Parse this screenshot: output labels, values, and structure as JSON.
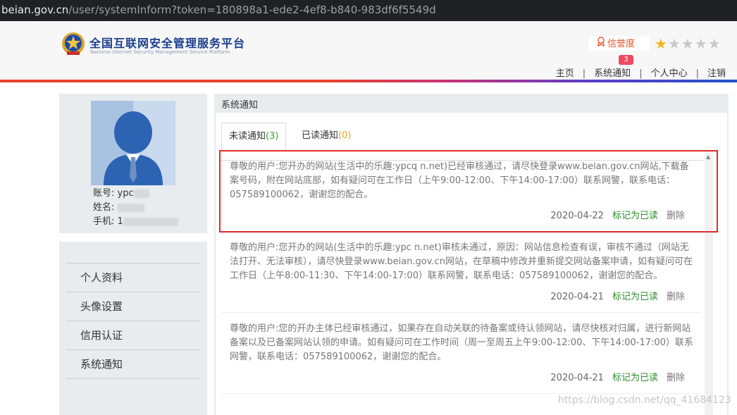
{
  "browser": {
    "host": "beian.gov.cn",
    "path": "/user/systemInform?token=180898a1-ede2-4ef8-b840-983df6f5549d"
  },
  "header": {
    "site_title": "全国互联网安全管理服务平台",
    "site_subtitle": "National Internet Security Management Service Platform",
    "credit_label": "信誉度",
    "rating": {
      "filled": 1,
      "total": 5
    },
    "nav": {
      "home": "主页",
      "notifications": "系统通知",
      "notifications_badge": "3",
      "personal_center": "个人中心",
      "logout": "注销",
      "separator": "|"
    }
  },
  "profile": {
    "account_label": "账号:",
    "account_value": "ypc",
    "name_label": "姓名:",
    "phone_label": "手机:",
    "phone_value": "1"
  },
  "sidebar": {
    "items": [
      {
        "label": "个人资料"
      },
      {
        "label": "头像设置"
      },
      {
        "label": "信用认证"
      },
      {
        "label": "系统通知"
      }
    ]
  },
  "panel": {
    "title": "系统通知",
    "tabs": [
      {
        "label": "未读通知",
        "count": "(3)"
      },
      {
        "label": "已读通知",
        "count": "(0)"
      }
    ],
    "notices": [
      {
        "text": "尊敬的用户:您开办的网站(生活中的乐趣:ypcq  n.net)已经审核通过，请尽快登录www.beian.gov.cn网站,下载备案号码，附在网站底部，如有疑问可在工作日（上午9:00-12:00、下午14:00-17:00）联系网警，联系电话：057589100062，谢谢您的配合。",
        "date": "2020-04-22",
        "mark_read": "标记为已读",
        "delete": "删除"
      },
      {
        "text": "尊敬的用户:您开办的网站(生活中的乐趣:ypc  n.net)审核未通过，原因：网站信息检查有误，审核不通过（网站无法打开、无法审核），请尽快登录www.beian.gov.cn网站，在草稿中修改并重新提交网站备案申请，如有疑问可在工作日（上午8:00-11:30、下午14:00-17:00）联系网警，联系电话：057589100062，谢谢您的配合。",
        "date": "2020-04-21",
        "mark_read": "标记为已读",
        "delete": "删除"
      },
      {
        "text": "尊敬的用户:您的开办主体已经审核通过，如果存在自动关联的待备案或待认领网站，请尽快核对归属，进行新网站备案以及已备案网站认领的申请。如有疑问可在工作时间（周一至周五上午9:00-12:00、下午14:00-17:00）联系网警，联系电话：057589100062，谢谢您的配合。",
        "date": "2020-04-21",
        "mark_read": "标记为已读",
        "delete": "删除"
      }
    ]
  },
  "watermark": "https://blog.csdn.net/qq_41684123",
  "colors": {
    "highlight": "#e32a2a",
    "brand_blue": "#1a3d8f",
    "mark_read_green": "#2e8b2e",
    "badge_red": "#ee4b63",
    "star_gold": "#f5b51c"
  }
}
